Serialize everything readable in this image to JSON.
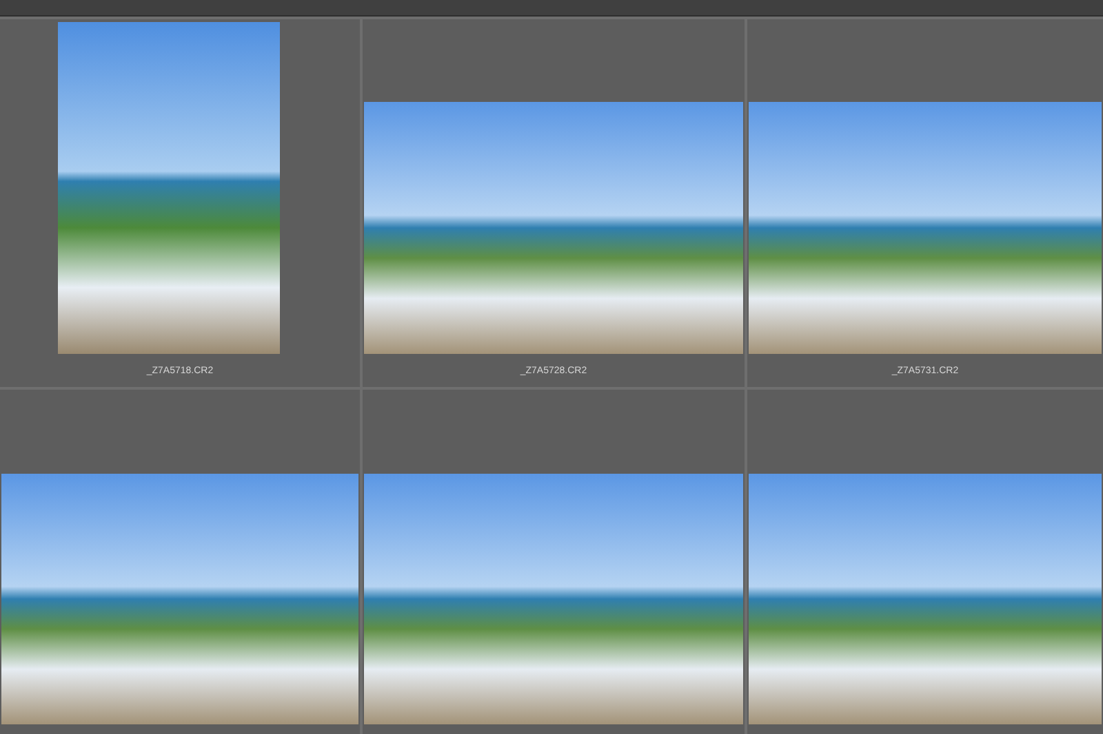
{
  "thumbnails": [
    {
      "kind": "portrait",
      "filename": "_Z7A5718.CR2"
    },
    {
      "kind": "landscape",
      "filename": "_Z7A5728.CR2"
    },
    {
      "kind": "landscape",
      "filename": "_Z7A5731.CR2"
    },
    {
      "kind": "landscape"
    },
    {
      "kind": "landscape"
    },
    {
      "kind": "landscape"
    }
  ]
}
